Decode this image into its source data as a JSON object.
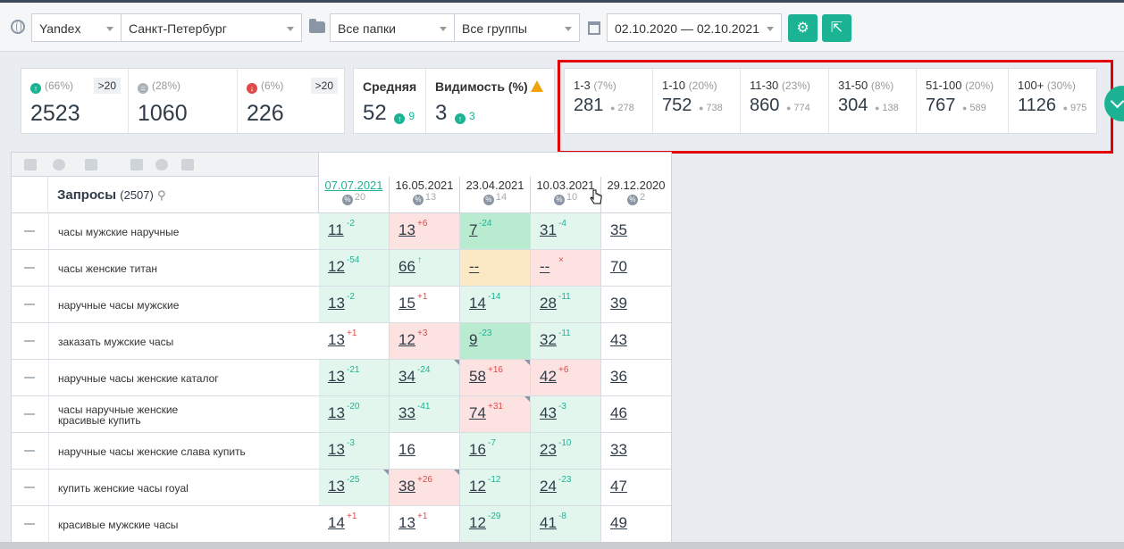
{
  "filters": {
    "engine": "Yandex",
    "region": "Санкт-Петербург",
    "folders": "Все папки",
    "groups": "Все группы",
    "daterange": "02.10.2020 — 02.10.2021"
  },
  "summary": {
    "up": {
      "pct": "(66%)",
      "gt": ">20",
      "value": "2523"
    },
    "same": {
      "pct": "(28%)",
      "value": "1060"
    },
    "down": {
      "pct": "(6%)",
      "gt": ">20",
      "value": "226"
    },
    "avg": {
      "label": "Средняя",
      "value": "52",
      "delta": "9"
    },
    "vis": {
      "label": "Видимость (%)",
      "value": "3",
      "delta": "3"
    }
  },
  "ranges": [
    {
      "label": "1-3",
      "pct": "(7%)",
      "value": "281",
      "prev": "278"
    },
    {
      "label": "1-10",
      "pct": "(20%)",
      "value": "752",
      "prev": "738"
    },
    {
      "label": "11-30",
      "pct": "(23%)",
      "value": "860",
      "prev": "774"
    },
    {
      "label": "31-50",
      "pct": "(8%)",
      "value": "304",
      "prev": "138"
    },
    {
      "label": "51-100",
      "pct": "(20%)",
      "value": "767",
      "prev": "589"
    },
    {
      "label": "100+",
      "pct": "(30%)",
      "value": "1126",
      "prev": "975"
    }
  ],
  "table": {
    "title": "Запросы",
    "count": "(2507)",
    "dates": [
      {
        "date": "07.07.2021",
        "cnt": "20"
      },
      {
        "date": "16.05.2021",
        "cnt": "13"
      },
      {
        "date": "23.04.2021",
        "cnt": "14"
      },
      {
        "date": "10.03.2021",
        "cnt": "10"
      },
      {
        "date": "29.12.2020",
        "cnt": "2"
      }
    ],
    "rows": [
      {
        "q": "часы мужские наручные",
        "cells": [
          [
            "11",
            "-2",
            "up"
          ],
          [
            "13",
            "+6",
            "down"
          ],
          [
            "7",
            "-24",
            "up"
          ],
          [
            "31",
            "-4",
            "up"
          ],
          [
            "35",
            "",
            ""
          ]
        ]
      },
      {
        "q": "часы женские титан",
        "cells": [
          [
            "12",
            "-54",
            "up"
          ],
          [
            "66",
            "↑",
            "up"
          ],
          [
            "--",
            "",
            ""
          ],
          [
            "--",
            "×",
            "down"
          ],
          [
            "70",
            "",
            ""
          ]
        ]
      },
      {
        "q": "наручные часы мужские",
        "cells": [
          [
            "13",
            "-2",
            "up"
          ],
          [
            "15",
            "+1",
            "down"
          ],
          [
            "14",
            "-14",
            "up"
          ],
          [
            "28",
            "-11",
            "up"
          ],
          [
            "39",
            "",
            ""
          ]
        ]
      },
      {
        "q": "заказать мужские часы",
        "cells": [
          [
            "13",
            "+1",
            "down"
          ],
          [
            "12",
            "+3",
            "down"
          ],
          [
            "9",
            "-23",
            "up"
          ],
          [
            "32",
            "-11",
            "up"
          ],
          [
            "43",
            "",
            ""
          ]
        ]
      },
      {
        "q": "наручные часы женские каталог",
        "cells": [
          [
            "13",
            "-21",
            "up"
          ],
          [
            "34",
            "-24",
            "up"
          ],
          [
            "58",
            "+16",
            "down"
          ],
          [
            "42",
            "+6",
            "down"
          ],
          [
            "36",
            "",
            ""
          ]
        ]
      },
      {
        "q": "часы наручные женские красивые купить",
        "cells": [
          [
            "13",
            "-20",
            "up"
          ],
          [
            "33",
            "-41",
            "up"
          ],
          [
            "74",
            "+31",
            "down"
          ],
          [
            "43",
            "-3",
            "up"
          ],
          [
            "46",
            "",
            ""
          ]
        ]
      },
      {
        "q": "наручные часы женские слава купить",
        "cells": [
          [
            "13",
            "-3",
            "up"
          ],
          [
            "16",
            "",
            ""
          ],
          [
            "16",
            "-7",
            "up"
          ],
          [
            "23",
            "-10",
            "up"
          ],
          [
            "33",
            "",
            ""
          ]
        ]
      },
      {
        "q": "купить женские часы royal",
        "cells": [
          [
            "13",
            "-25",
            "up"
          ],
          [
            "38",
            "+26",
            "down"
          ],
          [
            "12",
            "-12",
            "up"
          ],
          [
            "24",
            "-23",
            "up"
          ],
          [
            "47",
            "",
            ""
          ]
        ]
      },
      {
        "q": "красивые мужские часы",
        "cells": [
          [
            "14",
            "+1",
            "down"
          ],
          [
            "13",
            "+1",
            "down"
          ],
          [
            "12",
            "-29",
            "up"
          ],
          [
            "41",
            "-8",
            "up"
          ],
          [
            "49",
            "",
            ""
          ]
        ]
      }
    ]
  }
}
